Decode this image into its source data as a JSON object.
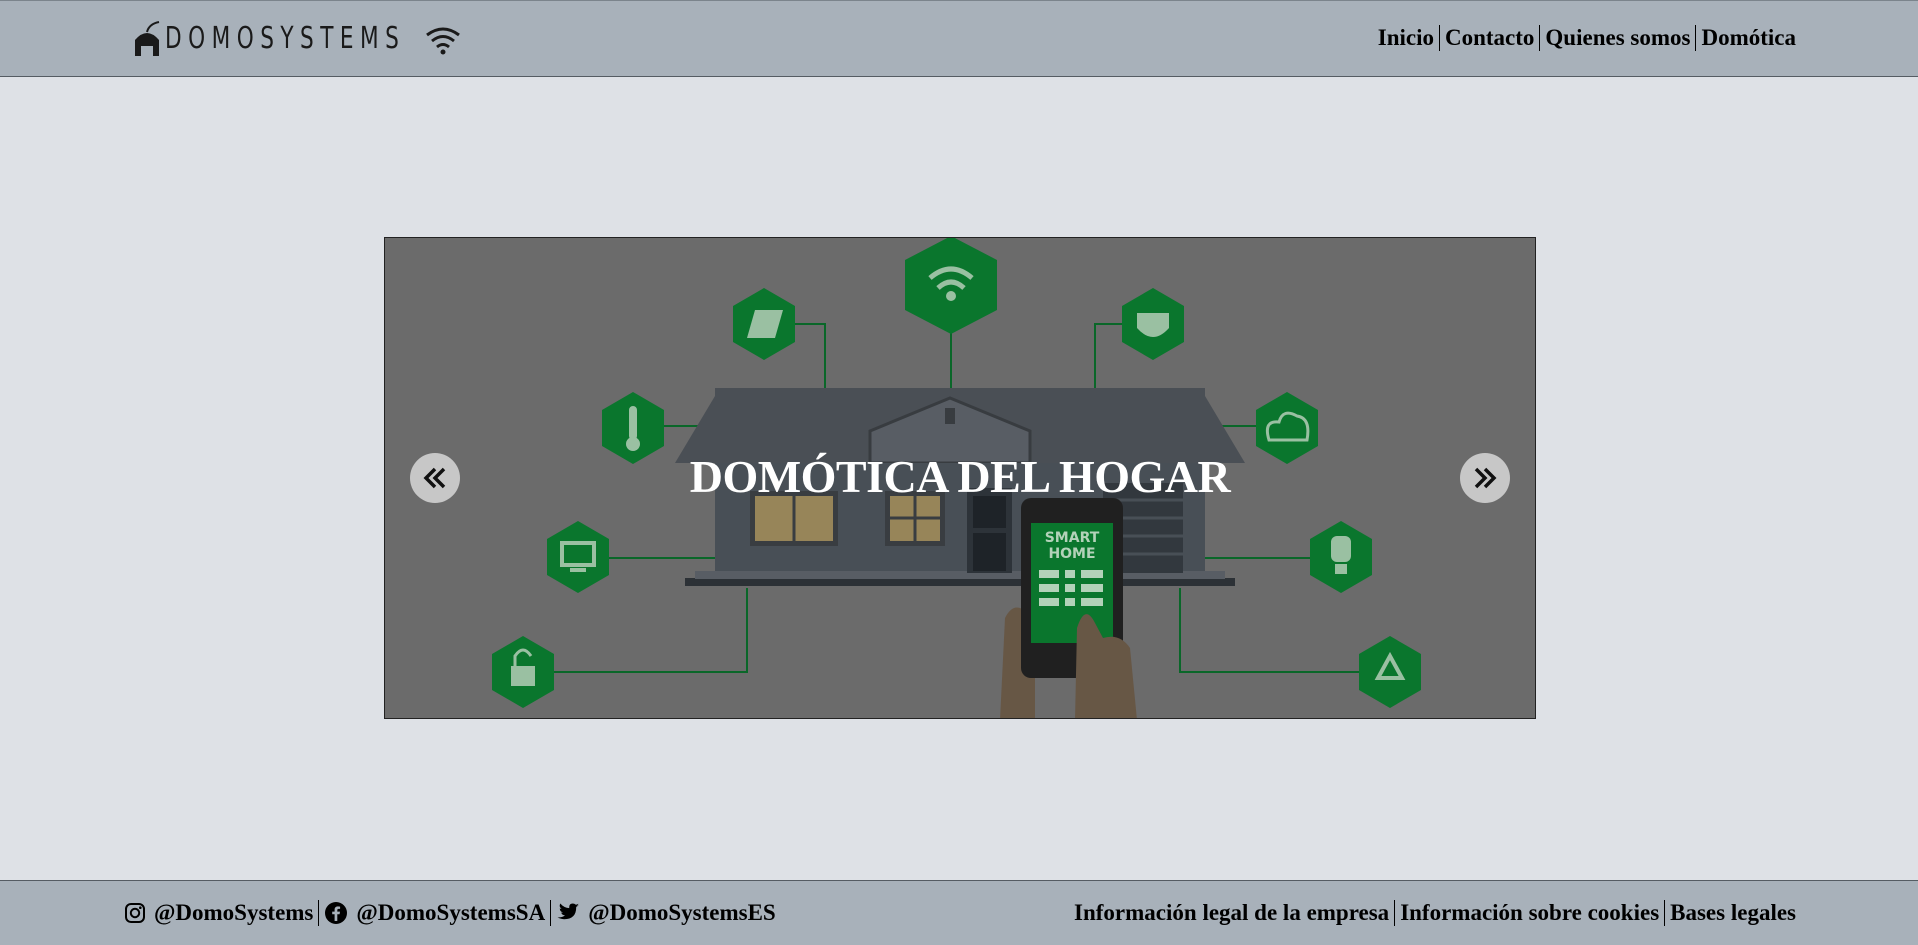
{
  "header": {
    "logo_text": "DOMOSYSTEMS",
    "nav": [
      {
        "label": "Inicio"
      },
      {
        "label": "Contacto"
      },
      {
        "label": "Quienes somos"
      },
      {
        "label": "Domótica"
      }
    ]
  },
  "carousel": {
    "caption": "DOMÓTICA DEL HOGAR",
    "phone_text_line1": "SMART",
    "phone_text_line2": "HOME",
    "prev_icon": "double-chevron-left-icon",
    "next_icon": "double-chevron-right-icon"
  },
  "footer": {
    "social": [
      {
        "icon": "instagram-icon",
        "handle": "@DomoSystems"
      },
      {
        "icon": "facebook-icon",
        "handle": "@DomoSystemsSA"
      },
      {
        "icon": "twitter-icon",
        "handle": "@DomoSystemsES"
      }
    ],
    "legal": [
      {
        "label": "Información legal de la empresa"
      },
      {
        "label": "Información sobre cookies"
      },
      {
        "label": "Bases legales"
      }
    ]
  },
  "colors": {
    "header_bg": "#a8b1ba",
    "page_bg": "#dee1e6",
    "accent_green": "#0b7a2f",
    "slide_overlay": "#6f6f6f"
  }
}
